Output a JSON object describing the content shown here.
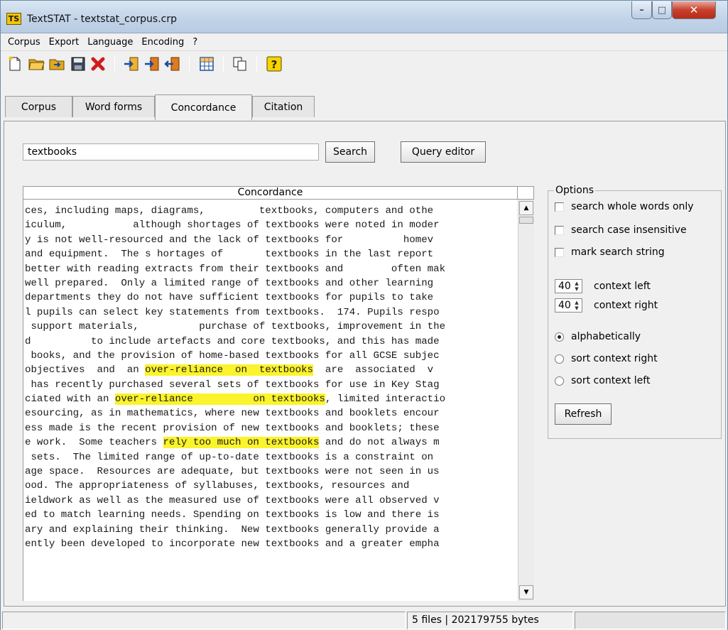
{
  "window": {
    "title": "TextSTAT - textstat_corpus.crp",
    "app_icon_letters": "TS",
    "controls": {
      "minimize": "–",
      "maximize": "□",
      "close": "✕"
    }
  },
  "menu": [
    "Corpus",
    "Export",
    "Language",
    "Encoding",
    "?"
  ],
  "toolbar_icons": [
    "new-corpus-icon",
    "open-corpus-icon",
    "open-folder-icon",
    "save-icon",
    "delete-icon",
    "add-file-icon",
    "add-folder-icon",
    "remove-file-icon",
    "table-icon",
    "copy-icon",
    "help-icon"
  ],
  "help_glyph": "?",
  "tabs": [
    {
      "label": "Corpus",
      "active": false
    },
    {
      "label": "Word forms",
      "active": false
    },
    {
      "label": "Concordance",
      "active": true
    },
    {
      "label": "Citation",
      "active": false
    }
  ],
  "search": {
    "value": "textbooks",
    "button": "Search",
    "query_editor": "Query editor"
  },
  "concordance": {
    "header": "Concordance",
    "lines": [
      [
        [
          "ces, including maps, diagrams,         textbooks, computers and othe",
          false
        ]
      ],
      [
        [
          "iculum,           although shortages of textbooks were noted in moder",
          false
        ]
      ],
      [
        [
          "y is not well-resourced and the lack of textbooks for          homev",
          false
        ]
      ],
      [
        [
          "and equipment.  The s hortages of       textbooks in the last report",
          false
        ]
      ],
      [
        [
          "better with reading extracts from their textbooks and        often mak",
          false
        ]
      ],
      [
        [
          "well prepared.  Only a limited range of textbooks and other learning",
          false
        ]
      ],
      [
        [
          "departments they do not have sufficient textbooks for pupils to take",
          false
        ]
      ],
      [
        [
          "l pupils can select key statements from textbooks.  174. Pupils respo",
          false
        ]
      ],
      [
        [
          " support materials,          purchase of textbooks, improvement in the",
          false
        ]
      ],
      [
        [
          "d          to include artefacts and core textbooks, and this has made",
          false
        ]
      ],
      [
        [
          " books, and the provision of home-based textbooks for all GCSE subjec",
          false
        ]
      ],
      [
        [
          "objectives  and  an ",
          false
        ],
        [
          "over-reliance  on  textbooks",
          true
        ],
        [
          "  are  associated  v",
          false
        ]
      ],
      [
        [
          " has recently purchased several sets of textbooks for use in Key Stag",
          false
        ]
      ],
      [
        [
          "ciated with an ",
          false
        ],
        [
          "over-reliance          on textbooks",
          true
        ],
        [
          ", limited interactio",
          false
        ]
      ],
      [
        [
          "esourcing, as in mathematics, where new textbooks and booklets encour",
          false
        ]
      ],
      [
        [
          "ess made is the recent provision of new textbooks and booklets; these",
          false
        ]
      ],
      [
        [
          "e work.  Some teachers ",
          false
        ],
        [
          "rely too much on textbooks",
          true
        ],
        [
          " and do not always m",
          false
        ]
      ],
      [
        [
          " sets.  The limited range of up-to-date textbooks is a constraint on",
          false
        ]
      ],
      [
        [
          "age space.  Resources are adequate, but textbooks were not seen in us",
          false
        ]
      ],
      [
        [
          "ood. The appropriateness of syllabuses, textbooks, resources and",
          false
        ]
      ],
      [
        [
          "ieldwork as well as the measured use of textbooks were all observed v",
          false
        ]
      ],
      [
        [
          "ed to match learning needs. Spending on textbooks is low and there is",
          false
        ]
      ],
      [
        [
          "ary and explaining their thinking.  New textbooks generally provide a",
          false
        ]
      ],
      [
        [
          "ently been developed to incorporate new textbooks and a greater empha",
          false
        ]
      ]
    ]
  },
  "options": {
    "legend": "Options",
    "checkboxes": [
      {
        "label": "search whole words only",
        "checked": false
      },
      {
        "label": "search case insensitive",
        "checked": false
      },
      {
        "label": "mark search string",
        "checked": false
      }
    ],
    "context_left": {
      "value": "40",
      "label": "context left"
    },
    "context_right": {
      "value": "40",
      "label": "context right"
    },
    "sort": [
      {
        "label": "alphabetically",
        "checked": true
      },
      {
        "label": "sort context right",
        "checked": false
      },
      {
        "label": "sort context left",
        "checked": false
      }
    ],
    "refresh": "Refresh"
  },
  "status": {
    "text": "5 files | 202179755 bytes"
  },
  "colors": {
    "highlight": "#fbf32b",
    "close_button": "#c8402c",
    "titlebar": "#c2d4e8"
  }
}
